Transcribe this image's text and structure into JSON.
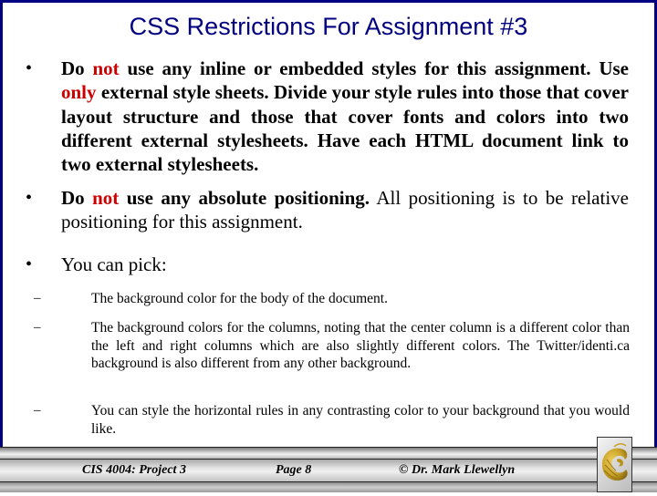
{
  "slide": {
    "title": "CSS Restrictions For Assignment #3",
    "colors": {
      "title": "#000080",
      "frame": "#000080",
      "emphasis": "#cc0000"
    },
    "bullets": [
      {
        "marker": "•",
        "segments": [
          {
            "text": "Do ",
            "style": "bold"
          },
          {
            "text": "not",
            "style": "red"
          },
          {
            "text": " use any inline or embedded styles for this assignment. Use ",
            "style": "bold"
          },
          {
            "text": "only",
            "style": "red"
          },
          {
            "text": " external style sheets.  Divide your style rules into those that cover layout structure and those that cover fonts and colors into two different external stylesheets.  Have each HTML document link to two external stylesheets.",
            "style": "bold"
          }
        ]
      },
      {
        "marker": "•",
        "segments": [
          {
            "text": "Do ",
            "style": "bold"
          },
          {
            "text": "not",
            "style": "red"
          },
          {
            "text": " use any absolute positioning.",
            "style": "bold"
          },
          {
            "text": "  All positioning is to be relative positioning for this assignment.",
            "style": "normal"
          }
        ]
      },
      {
        "marker": "•",
        "segments": [
          {
            "text": "You can pick:",
            "style": "normal"
          }
        ]
      }
    ],
    "sub_bullets": [
      {
        "marker": "–",
        "text": "The background color for the body of the document."
      },
      {
        "marker": "–",
        "text": "The background colors for the columns, noting that the center column is a different color than the left and right columns which are also slightly different colors. The Twitter/identi.ca background is also different from any other background."
      },
      {
        "marker": "–",
        "text": "You can style the horizontal rules in any contrasting color to your background that you would like."
      }
    ]
  },
  "footer": {
    "course": "CIS 4004:  Project 3",
    "page": "Page 8",
    "author": "© Dr. Mark Llewellyn",
    "logo_icon": "ucf-pegasus-logo-icon",
    "logo_color": "#c9a227"
  }
}
